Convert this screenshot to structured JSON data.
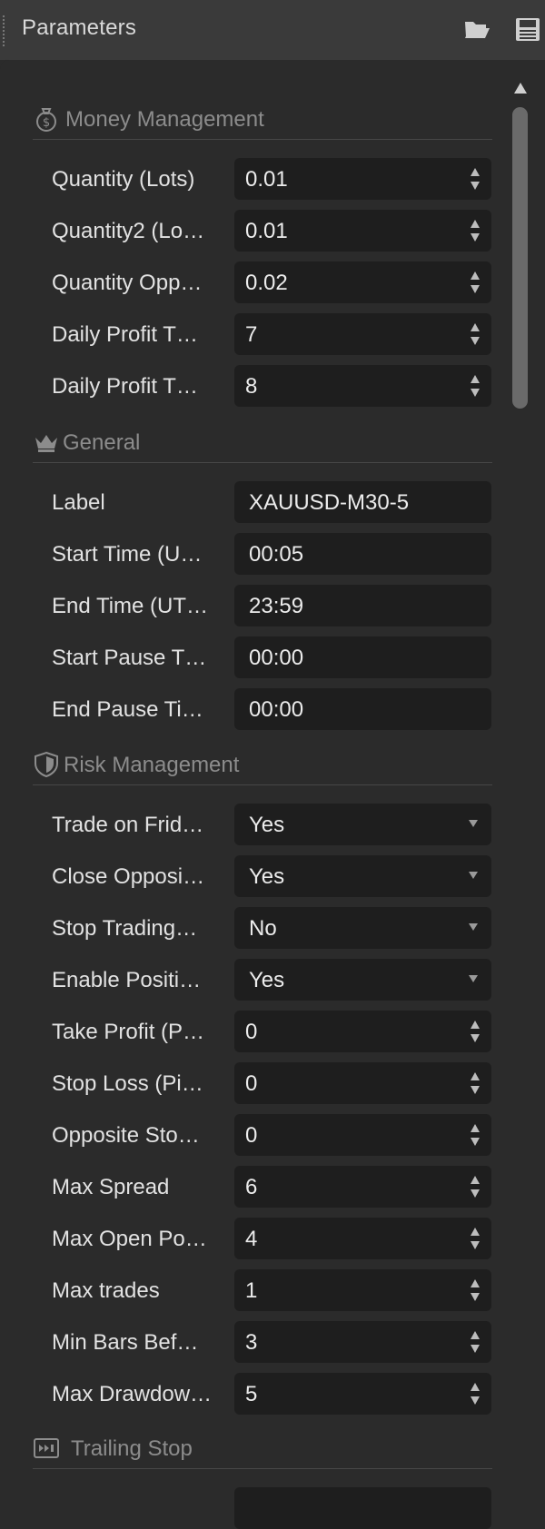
{
  "window": {
    "title": "Parameters"
  },
  "sections": {
    "money": {
      "title": "Money Management"
    },
    "general": {
      "title": "General"
    },
    "risk": {
      "title": "Risk Management"
    },
    "trailing": {
      "title": "Trailing Stop"
    }
  },
  "fields": {
    "quantity_lots": {
      "label": "Quantity (Lots)",
      "value": "0.01"
    },
    "quantity2_lots": {
      "label": "Quantity2 (Lo…",
      "value": "0.01"
    },
    "quantity_opp": {
      "label": "Quantity Opp…",
      "value": "0.02"
    },
    "daily_profit_1": {
      "label": "Daily Profit T…",
      "value": "7"
    },
    "daily_profit_2": {
      "label": "Daily Profit T…",
      "value": "8"
    },
    "label": {
      "label": "Label",
      "value": "XAUUSD-M30-5"
    },
    "start_time": {
      "label": "Start Time (U…",
      "value": "00:05"
    },
    "end_time": {
      "label": "End Time (UT…",
      "value": "23:59"
    },
    "start_pause": {
      "label": "Start Pause T…",
      "value": "00:00"
    },
    "end_pause": {
      "label": "End Pause Ti…",
      "value": "00:00"
    },
    "trade_friday": {
      "label": "Trade on Frid…",
      "value": "Yes"
    },
    "close_opposite": {
      "label": "Close Opposi…",
      "value": "Yes"
    },
    "stop_trading": {
      "label": "Stop Trading…",
      "value": "No"
    },
    "enable_position": {
      "label": "Enable Positi…",
      "value": "Yes"
    },
    "take_profit": {
      "label": "Take Profit (P…",
      "value": "0"
    },
    "stop_loss": {
      "label": "Stop Loss (Pi…",
      "value": "0"
    },
    "opposite_stop": {
      "label": "Opposite Sto…",
      "value": "0"
    },
    "max_spread": {
      "label": "Max Spread",
      "value": "6"
    },
    "max_open_pos": {
      "label": "Max Open Po…",
      "value": "4"
    },
    "max_trades": {
      "label": "Max trades",
      "value": "1"
    },
    "min_bars": {
      "label": "Min Bars Bef…",
      "value": "3"
    },
    "max_drawdown": {
      "label": "Max Drawdow…",
      "value": "5"
    }
  },
  "icons": {
    "open": "folder-open-icon",
    "save": "save-icon",
    "money": "money-bag-icon",
    "general": "crown-icon",
    "risk": "shield-icon",
    "trailing": "trailing-stop-icon",
    "spinner": "spinner-arrows-icon",
    "dropdown": "dropdown-arrow-icon",
    "scroll_up": "scroll-up-arrow-icon"
  },
  "colors": {
    "panel_bg": "#2b2b2b",
    "header_bg": "#3a3a3a",
    "field_bg": "#1e1e1e",
    "section_title": "#8c8c8c",
    "text": "#e2e2e2"
  }
}
